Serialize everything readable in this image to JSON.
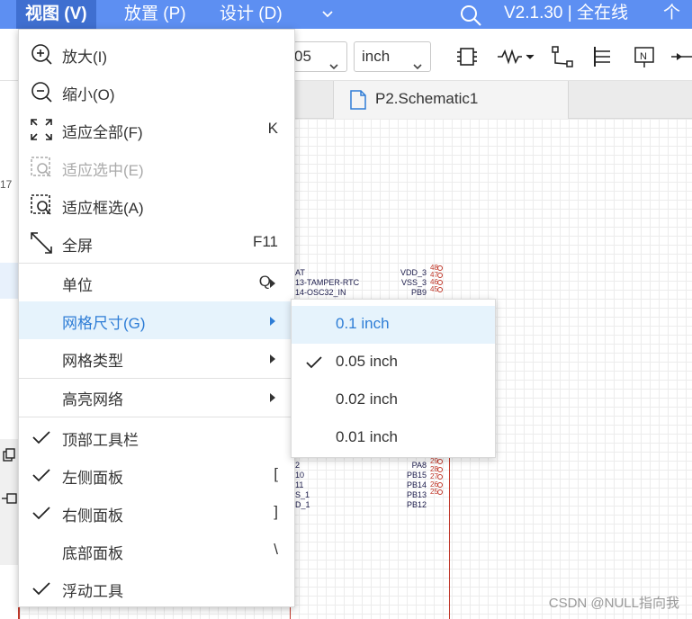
{
  "menubar": {
    "items": [
      {
        "label": "视图 (V)",
        "active": true
      },
      {
        "label": "放置 (P)",
        "active": false
      },
      {
        "label": "设计 (D)",
        "active": false
      }
    ],
    "version": "V2.1.30 | 全在线",
    "personal": "个人"
  },
  "toolbar": {
    "grid_value": "05",
    "unit_value": "inch"
  },
  "left_strip": {
    "text": "17"
  },
  "tab": {
    "label": "P2.Schematic1"
  },
  "view_menu": {
    "items": [
      {
        "icon": "zoom-in-icon",
        "label": "放大(I)",
        "shortcut": "",
        "disabled": false,
        "checked": false,
        "submenu": false
      },
      {
        "icon": "zoom-out-icon",
        "label": "缩小(O)",
        "shortcut": "",
        "disabled": false,
        "checked": false,
        "submenu": false
      },
      {
        "icon": "fit-all-icon",
        "label": "适应全部(F)",
        "shortcut": "K",
        "disabled": false,
        "checked": false,
        "submenu": false
      },
      {
        "icon": "fit-selection-icon",
        "label": "适应选中(E)",
        "shortcut": "",
        "disabled": true,
        "checked": false,
        "submenu": false
      },
      {
        "icon": "fit-box-icon",
        "label": "适应框选(A)",
        "shortcut": "",
        "disabled": false,
        "checked": false,
        "submenu": false
      },
      {
        "icon": "fullscreen-icon",
        "label": "全屏",
        "shortcut": "F11",
        "disabled": false,
        "checked": false,
        "submenu": false
      },
      {
        "icon": "",
        "label": "单位",
        "shortcut": "Q",
        "disabled": false,
        "checked": false,
        "submenu": true
      },
      {
        "icon": "",
        "label": "网格尺寸(G)",
        "shortcut": "",
        "disabled": false,
        "checked": false,
        "submenu": true,
        "highlighted": true
      },
      {
        "icon": "",
        "label": "网格类型",
        "shortcut": "",
        "disabled": false,
        "checked": false,
        "submenu": true
      },
      {
        "icon": "",
        "label": "高亮网络",
        "shortcut": "",
        "disabled": false,
        "checked": false,
        "submenu": true
      },
      {
        "icon": "check-icon",
        "label": "顶部工具栏",
        "shortcut": "",
        "disabled": false,
        "checked": true,
        "submenu": false
      },
      {
        "icon": "check-icon",
        "label": "左侧面板",
        "shortcut": "[",
        "disabled": false,
        "checked": true,
        "submenu": false
      },
      {
        "icon": "check-icon",
        "label": "右侧面板",
        "shortcut": "]",
        "disabled": false,
        "checked": true,
        "submenu": false
      },
      {
        "icon": "",
        "label": "底部面板",
        "shortcut": "\\",
        "disabled": false,
        "checked": false,
        "submenu": false
      },
      {
        "icon": "check-icon",
        "label": "浮动工具",
        "shortcut": "",
        "disabled": false,
        "checked": true,
        "submenu": false
      }
    ]
  },
  "grid_size_submenu": {
    "items": [
      {
        "label": "0.1 inch",
        "checked": false,
        "highlighted": true
      },
      {
        "label": "0.05 inch",
        "checked": true,
        "highlighted": false
      },
      {
        "label": "0.02 inch",
        "checked": false,
        "highlighted": false
      },
      {
        "label": "0.01 inch",
        "checked": false,
        "highlighted": false
      }
    ]
  },
  "schematic": {
    "pins_left_top": [
      "AT",
      "13-TAMPER-RTC",
      "14-OSC32_IN"
    ],
    "pins_right_top": [
      "VDD_3",
      "VSS_3",
      "PB9"
    ],
    "pin_numbers_top": [
      "48",
      "47",
      "46",
      "45"
    ],
    "pins_left_bottom": [
      "2",
      "10",
      "11",
      "S_1",
      "D_1"
    ],
    "pins_right_bottom": [
      "PA8",
      "PB15",
      "PB14",
      "PB13",
      "PB12"
    ],
    "pin_numbers_bottom": [
      "29",
      "28",
      "27",
      "26",
      "25"
    ]
  },
  "watermark": "CSDN @NULL指向我"
}
